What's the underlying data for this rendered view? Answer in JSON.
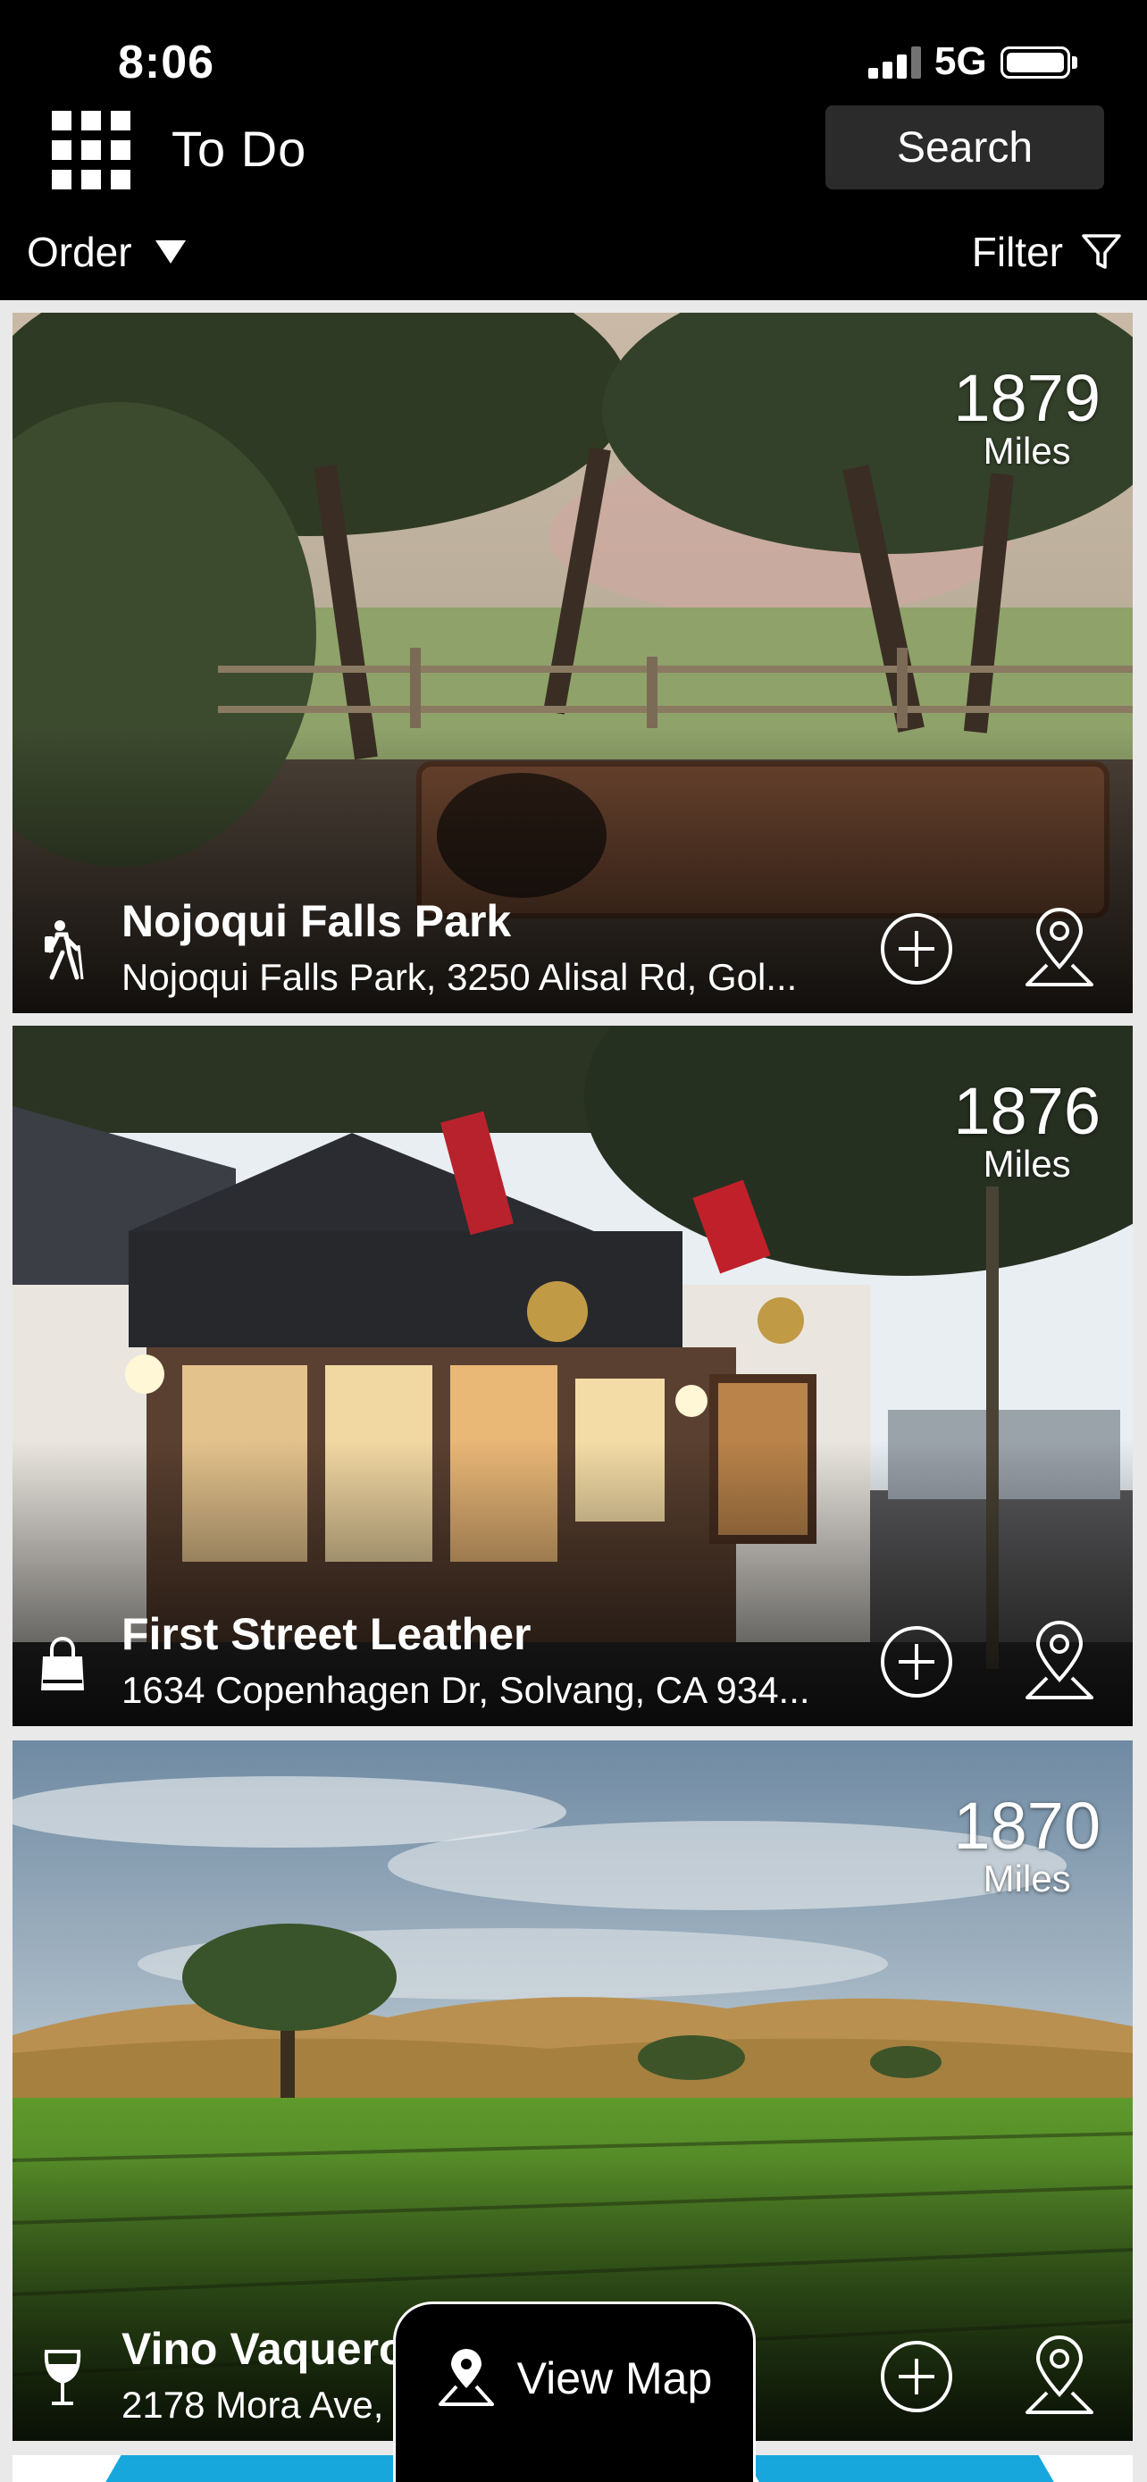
{
  "status_bar": {
    "time": "8:06",
    "network": "5G"
  },
  "header": {
    "menu_icon": "grid-menu-icon",
    "title": "To Do",
    "search_label": "Search"
  },
  "toolbar": {
    "order_label": "Order",
    "filter_label": "Filter"
  },
  "cards": [
    {
      "name": "Nojoqui Falls Park",
      "address": "Nojoqui Falls Park, 3250 Alisal Rd, Gol...",
      "distance": "1879",
      "unit": "Miles",
      "category_icon": "hiking-icon"
    },
    {
      "name": "First Street Leather",
      "address": "1634 Copenhagen Dr, Solvang, CA 934...",
      "distance": "1876",
      "unit": "Miles",
      "category_icon": "shopping-bag-icon"
    },
    {
      "name": "Vino Vaquero Saloon Tasting",
      "address": "2178 Mora Ave, Solvang, CA 93460",
      "distance": "1870",
      "unit": "Miles",
      "category_icon": "wine-glass-icon"
    }
  ],
  "view_map_label": "View Map",
  "colors": {
    "header_bg": "#000000",
    "search_bg": "#2b2b2b",
    "peek_accent": "#17a7dd"
  }
}
